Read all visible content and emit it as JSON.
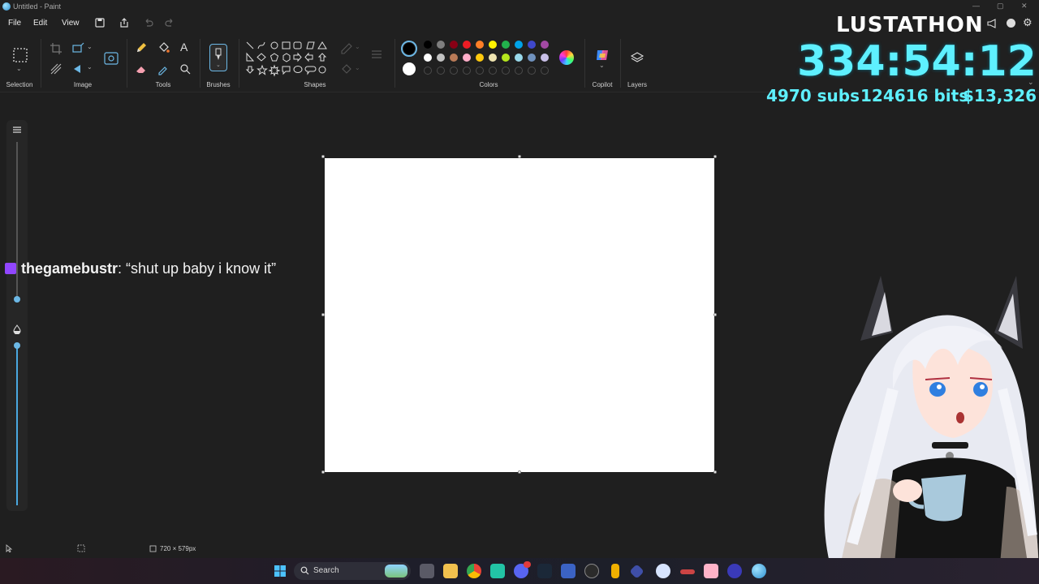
{
  "window": {
    "title": "Untitled - Paint"
  },
  "menu": {
    "file": "File",
    "edit": "Edit",
    "view": "View"
  },
  "ribbon": {
    "groups": {
      "selection": "Selection",
      "image": "Image",
      "tools": "Tools",
      "brushes": "Brushes",
      "shapes": "Shapes",
      "colors": "Colors",
      "copilot": "Copilot",
      "layers": "Layers"
    },
    "palette_row1": [
      "#000000",
      "#7f7f7f",
      "#880015",
      "#ed1c24",
      "#ff7f27",
      "#fff200",
      "#22b14c",
      "#00a2e8",
      "#3f48cc",
      "#a349a4"
    ],
    "palette_row2": [
      "#ffffff",
      "#c3c3c3",
      "#b97a57",
      "#ffaec9",
      "#ffc90e",
      "#efe4b0",
      "#b5e61d",
      "#99d9ea",
      "#7092be",
      "#c8bfe7"
    ],
    "primary_color": "#000000",
    "secondary_color": "#ffffff"
  },
  "status": {
    "canvas_size": "720 × 579px"
  },
  "taskbar": {
    "search_label": "Search"
  },
  "overlay": {
    "title": "LUSTATHON",
    "timer": "334:54:12",
    "subs": "4970 subs",
    "bits": "124616 bits",
    "money": "$13,326"
  },
  "chat": {
    "user": "thegamebustr",
    "message": ": “shut up baby i know it”"
  }
}
